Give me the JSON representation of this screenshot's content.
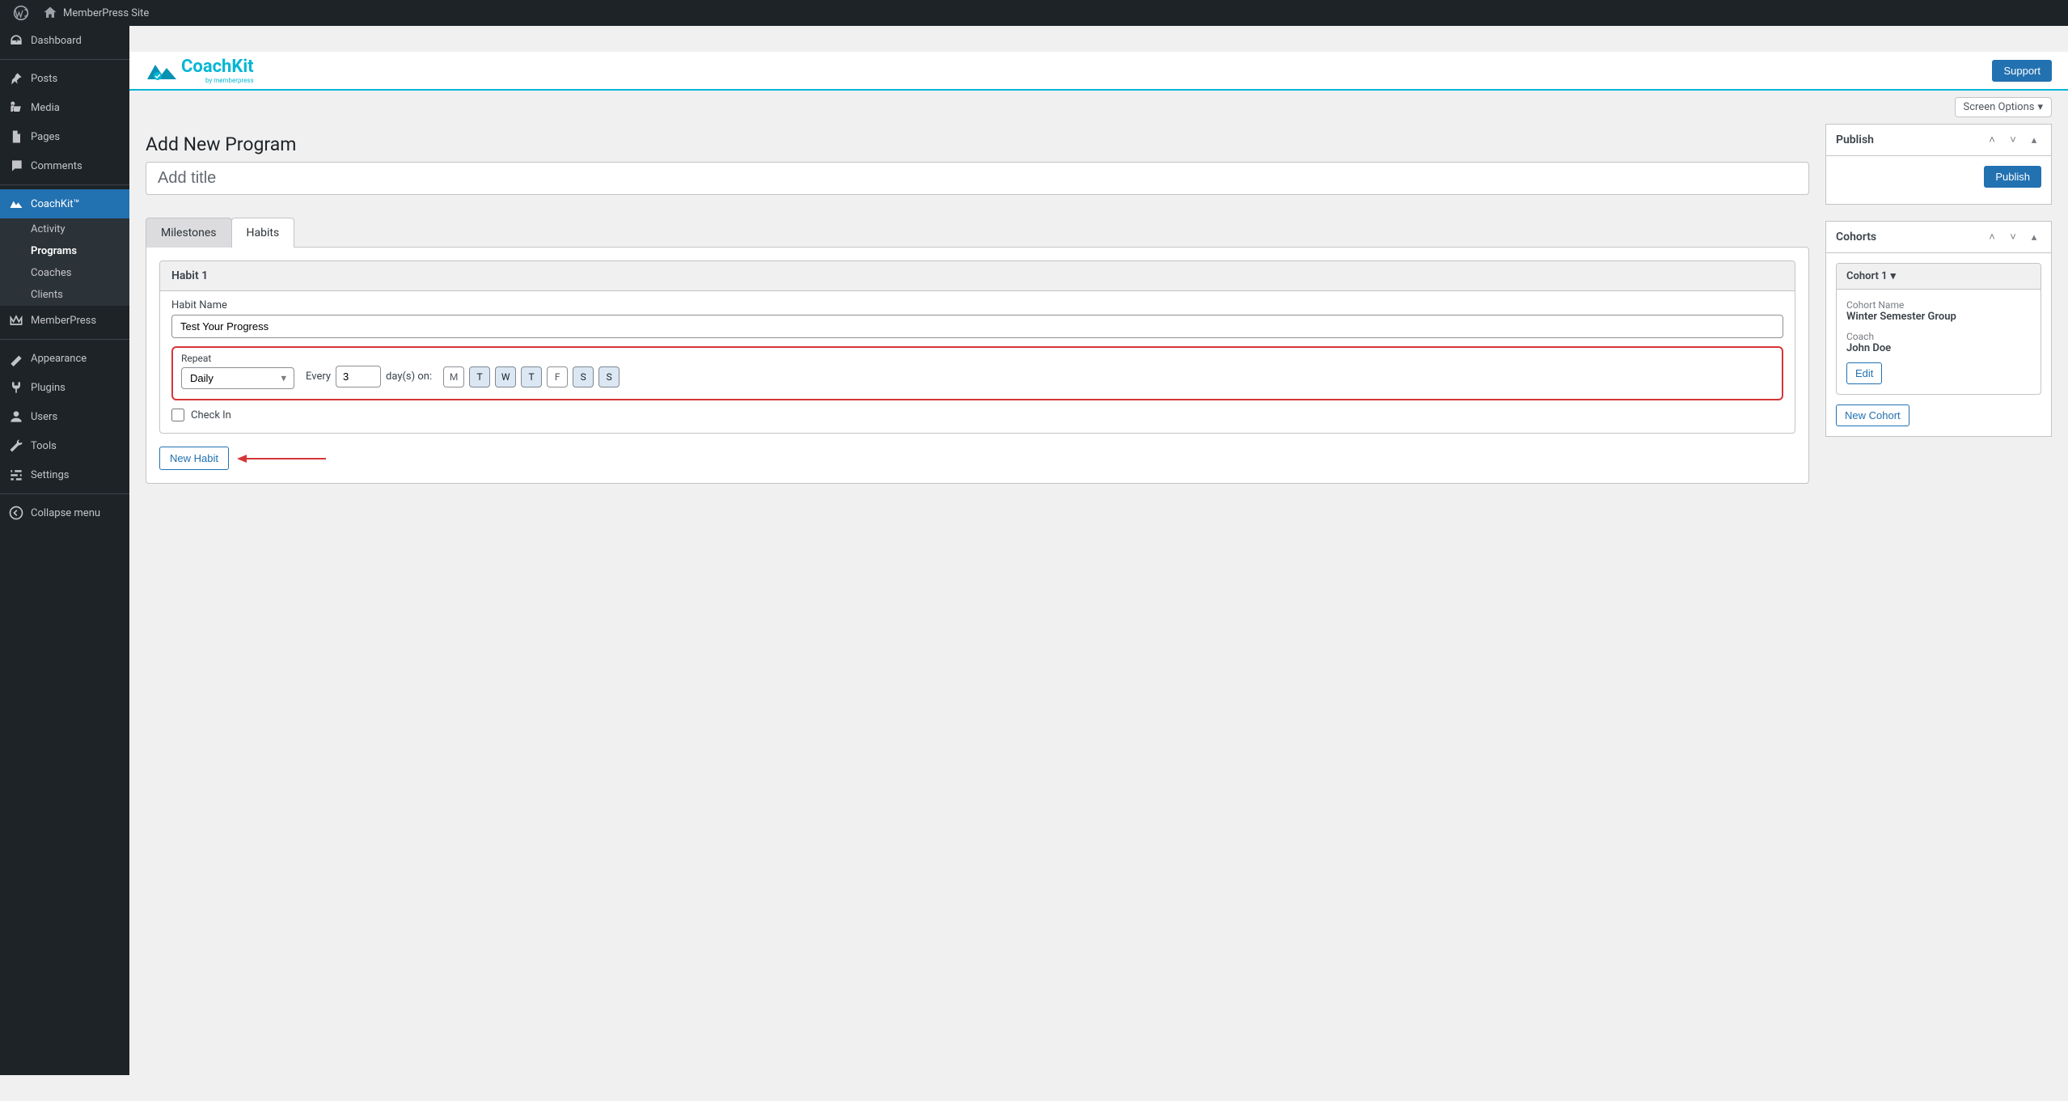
{
  "adminBar": {
    "siteName": "MemberPress Site"
  },
  "sidebar": {
    "items": [
      {
        "label": "Dashboard",
        "icon": "dashboard"
      },
      {
        "label": "Posts",
        "icon": "pin"
      },
      {
        "label": "Media",
        "icon": "media"
      },
      {
        "label": "Pages",
        "icon": "pages"
      },
      {
        "label": "Comments",
        "icon": "comments"
      }
    ],
    "coachkit": {
      "label": "CoachKit™"
    },
    "coachkitSub": [
      {
        "label": "Activity"
      },
      {
        "label": "Programs"
      },
      {
        "label": "Coaches"
      },
      {
        "label": "Clients"
      }
    ],
    "memberpress": {
      "label": "MemberPress"
    },
    "items2": [
      {
        "label": "Appearance",
        "icon": "appearance"
      },
      {
        "label": "Plugins",
        "icon": "plugins"
      },
      {
        "label": "Users",
        "icon": "users"
      },
      {
        "label": "Tools",
        "icon": "tools"
      },
      {
        "label": "Settings",
        "icon": "settings"
      },
      {
        "label": "Collapse menu",
        "icon": "collapse"
      }
    ]
  },
  "brand": {
    "name": "CoachKit",
    "sub": "by memberpress",
    "supportLabel": "Support"
  },
  "screenOptions": {
    "label": "Screen Options"
  },
  "page": {
    "heading": "Add New Program",
    "titlePlaceholder": "Add title",
    "titleValue": ""
  },
  "tabs": {
    "milestones": "Milestones",
    "habits": "Habits"
  },
  "habit": {
    "cardTitle": "Habit 1",
    "nameLabel": "Habit Name",
    "nameValue": "Test Your Progress",
    "repeatLabel": "Repeat",
    "repeatValue": "Daily",
    "everyLabel": "Every",
    "everyValue": "3",
    "daysOnLabel": "day(s) on:",
    "days": [
      {
        "label": "M",
        "selected": false
      },
      {
        "label": "T",
        "selected": true
      },
      {
        "label": "W",
        "selected": true
      },
      {
        "label": "T",
        "selected": true
      },
      {
        "label": "F",
        "selected": false
      },
      {
        "label": "S",
        "selected": true
      },
      {
        "label": "S",
        "selected": true
      }
    ],
    "checkInLabel": "Check In",
    "checkInChecked": false,
    "newHabitLabel": "New Habit"
  },
  "publishBox": {
    "title": "Publish",
    "buttonLabel": "Publish"
  },
  "cohortsBox": {
    "title": "Cohorts",
    "cohortName": "Cohort 1",
    "cohortNameLabel": "Cohort Name",
    "cohortNameValue": "Winter Semester Group",
    "coachLabel": "Coach",
    "coachValue": "John Doe",
    "editLabel": "Edit",
    "newCohortLabel": "New Cohort"
  }
}
